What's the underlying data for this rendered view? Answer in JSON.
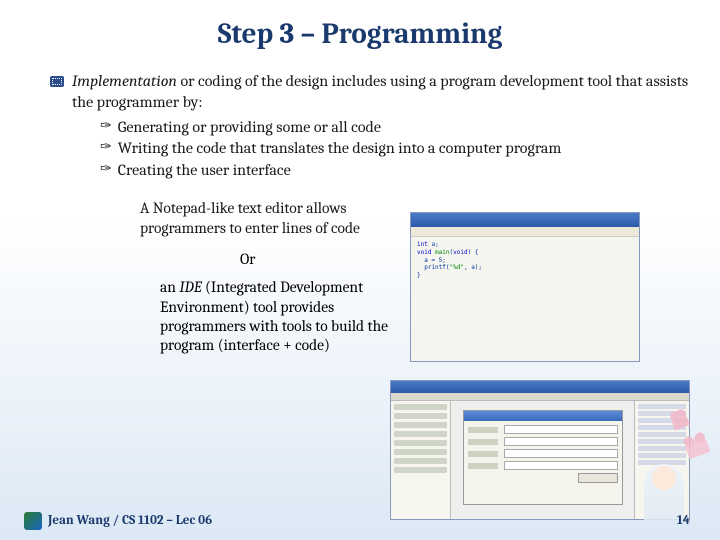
{
  "title": "Step 3 – Programming",
  "main": {
    "lead_em": "Implementation",
    "lead_rest": " or coding of the design includes using a program development tool that assists the programmer by:",
    "subs": [
      "Generating or providing some or all code",
      "Writing the code that translates the design into a computer program",
      "Creating the user interface"
    ]
  },
  "notepad_block": "A Notepad-like text editor allows programmers to enter lines of code",
  "or_label": "Or",
  "ide_block_pre": "an ",
  "ide_em": "IDE",
  "ide_block_post": " (Integrated Development Environment) tool provides programmers with tools to build the program (interface + code)",
  "footer": {
    "left": "Jean Wang / CS 1102 – Lec 06",
    "page": "14"
  },
  "code_snippet": "int a;\nvoid main(void) {\n  a = 5;\n  printf(\"%d\", a);\n}"
}
